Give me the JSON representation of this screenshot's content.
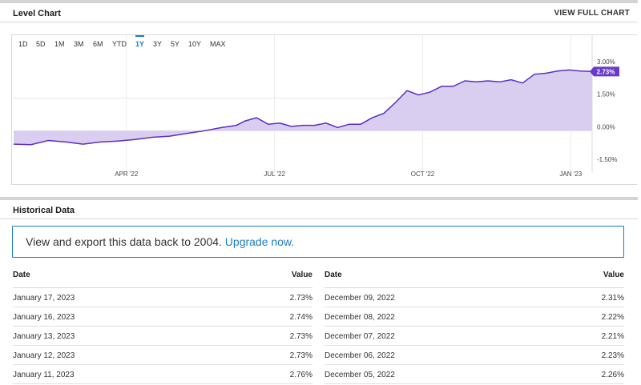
{
  "level_chart": {
    "title": "Level Chart",
    "full_chart_link": "VIEW FULL CHART",
    "ranges": [
      {
        "label": "1D",
        "active": false
      },
      {
        "label": "5D",
        "active": false
      },
      {
        "label": "1M",
        "active": false
      },
      {
        "label": "3M",
        "active": false
      },
      {
        "label": "6M",
        "active": false
      },
      {
        "label": "YTD",
        "active": false
      },
      {
        "label": "1Y",
        "active": true
      },
      {
        "label": "3Y",
        "active": false
      },
      {
        "label": "5Y",
        "active": false
      },
      {
        "label": "10Y",
        "active": false
      },
      {
        "label": "MAX",
        "active": false
      }
    ]
  },
  "chart_data": {
    "type": "area",
    "x_ticks": [
      "APR '22",
      "JUL '22",
      "OCT '22",
      "JAN '23"
    ],
    "y_ticks": [
      "3.00%",
      "1.50%",
      "0.00%",
      "-1.50%"
    ],
    "ylim": [
      -1.5,
      3.0
    ],
    "xlim": [
      0,
      1
    ],
    "grid": true,
    "current_value_label": "2.73%",
    "current_value": 2.73,
    "colors": {
      "line": "#5b2fc2",
      "fill": "#d9cdf0",
      "badge": "#6a3bc9"
    },
    "series": [
      {
        "x": [
          0,
          0.03,
          0.06,
          0.09,
          0.12,
          0.15,
          0.18,
          0.21,
          0.24,
          0.27,
          0.3,
          0.33,
          0.36,
          0.385,
          0.4,
          0.42,
          0.44,
          0.46,
          0.48,
          0.5,
          0.52,
          0.54,
          0.56,
          0.58,
          0.6,
          0.62,
          0.64,
          0.66,
          0.68,
          0.7,
          0.72,
          0.74,
          0.76,
          0.78,
          0.8,
          0.82,
          0.84,
          0.86,
          0.88,
          0.9,
          0.92,
          0.94,
          0.96,
          0.98,
          1.0
        ],
        "y": [
          -0.62,
          -0.64,
          -0.45,
          -0.52,
          -0.62,
          -0.52,
          -0.48,
          -0.4,
          -0.3,
          -0.25,
          -0.12,
          0.0,
          0.15,
          0.25,
          0.45,
          0.6,
          0.3,
          0.35,
          0.2,
          0.25,
          0.25,
          0.35,
          0.15,
          0.3,
          0.3,
          0.6,
          0.8,
          1.3,
          1.85,
          1.65,
          1.78,
          2.05,
          2.05,
          2.3,
          2.25,
          2.3,
          2.25,
          2.35,
          2.2,
          2.6,
          2.65,
          2.75,
          2.8,
          2.75,
          2.73
        ]
      }
    ]
  },
  "historical": {
    "title": "Historical Data",
    "cta_text": "View and export this data back to 2004.",
    "cta_link": "Upgrade now.",
    "col_date": "Date",
    "col_value": "Value",
    "left_rows": [
      {
        "date": "January 17, 2023",
        "value": "2.73%"
      },
      {
        "date": "January 16, 2023",
        "value": "2.74%"
      },
      {
        "date": "January 13, 2023",
        "value": "2.73%"
      },
      {
        "date": "January 12, 2023",
        "value": "2.73%"
      },
      {
        "date": "January 11, 2023",
        "value": "2.76%"
      }
    ],
    "right_rows": [
      {
        "date": "December 09, 2022",
        "value": "2.31%"
      },
      {
        "date": "December 08, 2022",
        "value": "2.22%"
      },
      {
        "date": "December 07, 2022",
        "value": "2.21%"
      },
      {
        "date": "December 06, 2022",
        "value": "2.23%"
      },
      {
        "date": "December 05, 2022",
        "value": "2.26%"
      }
    ]
  }
}
